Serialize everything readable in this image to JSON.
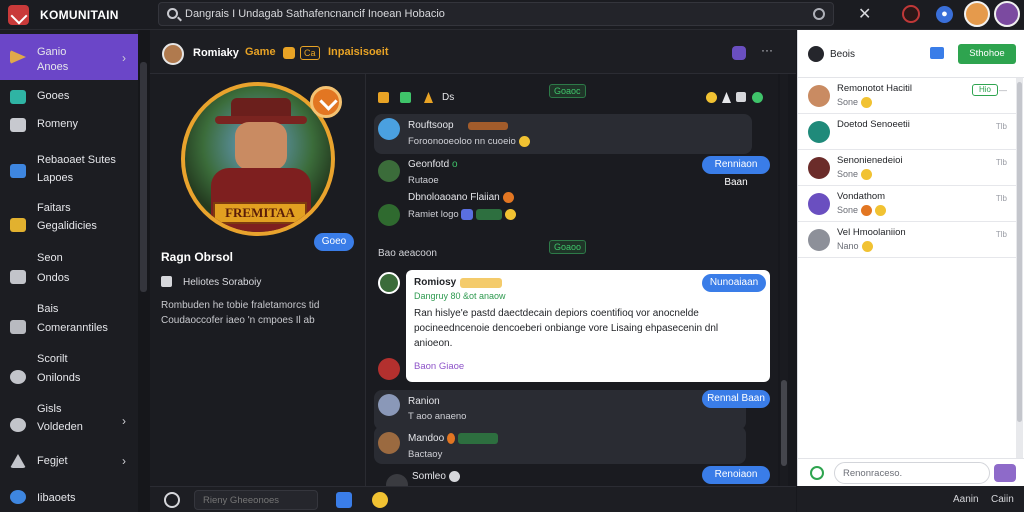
{
  "app": {
    "name": "KOMUNITAIN"
  },
  "search": {
    "placeholder": "Dangrais I Undagab Sathafencnancif Inoean Hobacio"
  },
  "sidebar": {
    "items": [
      {
        "l1": "Ganio",
        "l2": "Anoes",
        "active": true,
        "chev": "›"
      },
      {
        "l1": "Gooes",
        "l2": ""
      },
      {
        "l1": "Romeny",
        "l2": ""
      },
      {
        "l1": "Rebaoaet Sutes",
        "l2": "Lapoes"
      },
      {
        "l1": "Faitars",
        "l2": "Gegalidicies"
      },
      {
        "l1": "Seon",
        "l2": "Ondos"
      },
      {
        "l1": "Bais",
        "l2": "Comeranntiles"
      },
      {
        "l1": "Scorilt",
        "l2": "Onilonds"
      },
      {
        "l1": "Gisls",
        "l2": "Voldeden",
        "chev": "›"
      },
      {
        "l1": "Fegjet",
        "l2": "",
        "chev": "›"
      },
      {
        "l1": "Iibaoets",
        "l2": ""
      }
    ]
  },
  "chat": {
    "title": "Romiaky",
    "game_label": "Game",
    "subtitle": "Inpaisisoeit"
  },
  "profile": {
    "avatar_title": "FREMITAA",
    "follow_label": "Goeo",
    "name": "Ragn Obrsol",
    "handle": "Heliotes Soraboiy",
    "bio_1": "Rombuden he tobie fraletamorcs tid",
    "bio_2": "Coudaoccofer iaeo 'n cmpoes Il ab"
  },
  "feed": {
    "toolbar_text": "Ds",
    "center_tag_1": "Goaoc",
    "center_tag_2": "Goaoo",
    "section_label": "Bao aeacoon",
    "messages": [
      {
        "name": "Rouftsoop",
        "text": "Foroonooeoloo nn cuoeio"
      },
      {
        "name": "Geonfotd",
        "extra": "o",
        "text": "Rutaoe"
      },
      {
        "name": "Dbnoloaoano Flaiian",
        "text": "Ramiet logo"
      },
      {
        "name": "Romiosy",
        "handle": "Dangruy 80 &ot anaow",
        "body_1": "Ran hislye'e pastd daectdecain depiors coentifioq vor anocnelde",
        "body_2": "pocineedncenoie dencoeberi onbiange vore Lisaing ehpasecenin dnl",
        "body_3": "anioeon.",
        "link": "Baon Giaoe"
      },
      {
        "name": "Ranion",
        "text": "T aoo anaeno"
      },
      {
        "name": "Mandoo",
        "text": "Bactaoy"
      },
      {
        "name": "Somleo",
        "text": ""
      }
    ],
    "pill_labels": [
      "Renniaon Baan",
      "Nunoaiaan",
      "Rennal Baan",
      "Renoiaon Baan"
    ]
  },
  "bottom": {
    "input_placeholder": "Rieny Gheeonoes"
  },
  "right": {
    "title": "Beois",
    "action_label": "Sthohoe",
    "list": [
      {
        "name": "Remonotot Hacitil",
        "sub": "Sone",
        "time": "—",
        "badge": "Hio"
      },
      {
        "name": "Doetod Senoeetii",
        "sub": "",
        "time": "Tlb"
      },
      {
        "name": "Senonienedeioi",
        "sub": "Sone",
        "time": "Tlb"
      },
      {
        "name": "Vondathom",
        "sub": "Sone",
        "time": "Tlb"
      },
      {
        "name": "Vel Hmoolaniion",
        "sub": "Nano",
        "time": "Tlb"
      }
    ],
    "input_placeholder": "Renonraceso.",
    "footer_1": "Aanin",
    "footer_2": "Caiin"
  }
}
